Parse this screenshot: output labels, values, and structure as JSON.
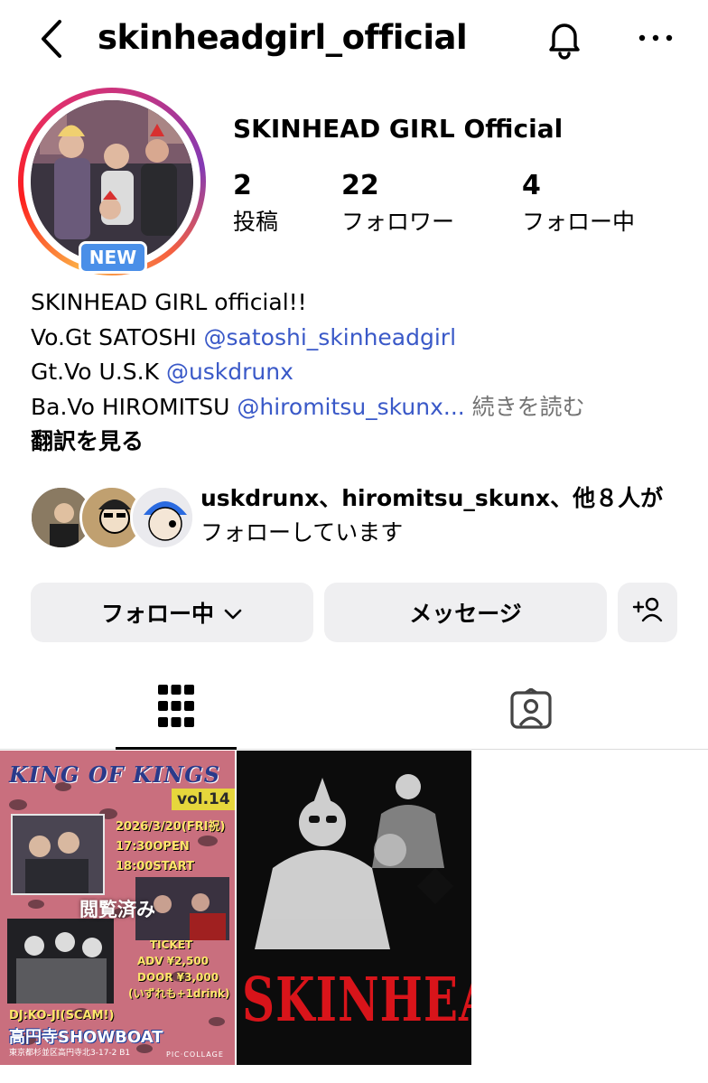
{
  "header": {
    "username": "skinheadgirl_official"
  },
  "profile": {
    "display_name": "SKINHEAD GIRL Official",
    "new_badge": "NEW",
    "stats": [
      {
        "value": "2",
        "label": "投稿"
      },
      {
        "value": "22",
        "label": "フォロワー"
      },
      {
        "value": "4",
        "label": "フォロー中"
      }
    ]
  },
  "bio": {
    "line1": "SKINHEAD GIRL official!!",
    "line2_prefix": "Vo.Gt SATOSHI ",
    "line2_mention": "@satoshi_skinheadgirl",
    "line3_prefix": "Gt.Vo U.S.K ",
    "line3_mention": "@uskdrunx",
    "line4_prefix": "Ba.Vo HIROMITSU ",
    "line4_mention": "@hiromitsu_skunx...",
    "read_more": "続きを読む",
    "translate": "翻訳を見る"
  },
  "followed_by": {
    "names": "uskdrunx、hiromitsu_skunx、他８人が",
    "suffix": "フォローしています"
  },
  "buttons": {
    "following": "フォロー中",
    "message": "メッセージ"
  },
  "posts": [
    {
      "title": "KING OF KINGS",
      "vol": "vol.14",
      "date_lines": [
        "2026/3/20(FRI祝)",
        "17:30OPEN",
        "18:00START"
      ],
      "ticket_lines": [
        "TICKET",
        "ADV ¥2,500",
        "DOOR ¥3,000",
        "(いずれも+1drink)"
      ],
      "dj": "DJ:KO-JI(SCAM!)",
      "venue": "高円寺SHOWBOAT",
      "address": "東京都杉並区高円寺北3-17-2 B1",
      "credit": "PIC·COLLAGE",
      "seen_label": "閲覧済み"
    },
    {
      "title": "SKINHEAD"
    }
  ]
}
